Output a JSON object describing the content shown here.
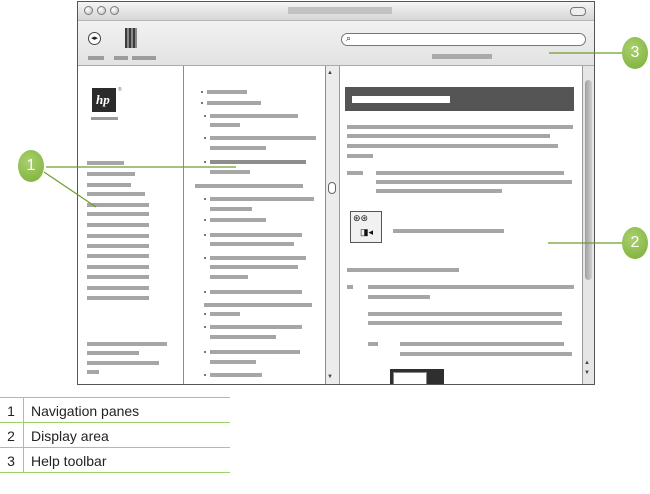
{
  "callouts": [
    {
      "number": "1"
    },
    {
      "number": "2"
    },
    {
      "number": "3"
    }
  ],
  "legend": [
    {
      "number": "1",
      "label": "Navigation panes"
    },
    {
      "number": "2",
      "label": "Display area"
    },
    {
      "number": "3",
      "label": "Help toolbar"
    }
  ],
  "logo": {
    "text": "hp"
  },
  "colors": {
    "callout": "#86b842",
    "rule": "#9fcf6a"
  }
}
